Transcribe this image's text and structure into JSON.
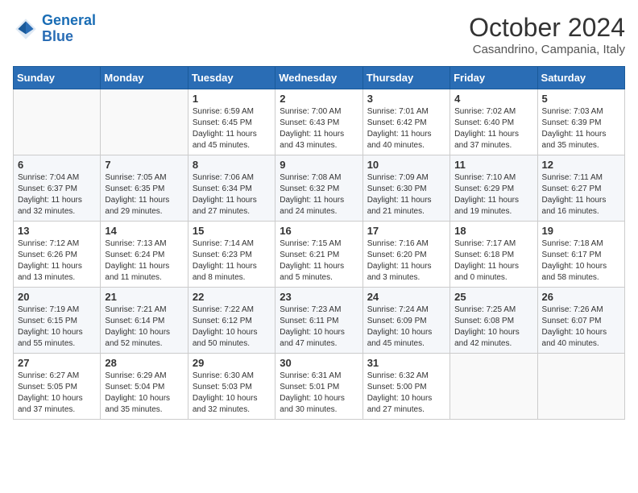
{
  "header": {
    "logo_line1": "General",
    "logo_line2": "Blue",
    "month_title": "October 2024",
    "subtitle": "Casandrino, Campania, Italy"
  },
  "days_of_week": [
    "Sunday",
    "Monday",
    "Tuesday",
    "Wednesday",
    "Thursday",
    "Friday",
    "Saturday"
  ],
  "weeks": [
    [
      {
        "day": "",
        "info": ""
      },
      {
        "day": "",
        "info": ""
      },
      {
        "day": "1",
        "info": "Sunrise: 6:59 AM\nSunset: 6:45 PM\nDaylight: 11 hours and 45 minutes."
      },
      {
        "day": "2",
        "info": "Sunrise: 7:00 AM\nSunset: 6:43 PM\nDaylight: 11 hours and 43 minutes."
      },
      {
        "day": "3",
        "info": "Sunrise: 7:01 AM\nSunset: 6:42 PM\nDaylight: 11 hours and 40 minutes."
      },
      {
        "day": "4",
        "info": "Sunrise: 7:02 AM\nSunset: 6:40 PM\nDaylight: 11 hours and 37 minutes."
      },
      {
        "day": "5",
        "info": "Sunrise: 7:03 AM\nSunset: 6:39 PM\nDaylight: 11 hours and 35 minutes."
      }
    ],
    [
      {
        "day": "6",
        "info": "Sunrise: 7:04 AM\nSunset: 6:37 PM\nDaylight: 11 hours and 32 minutes."
      },
      {
        "day": "7",
        "info": "Sunrise: 7:05 AM\nSunset: 6:35 PM\nDaylight: 11 hours and 29 minutes."
      },
      {
        "day": "8",
        "info": "Sunrise: 7:06 AM\nSunset: 6:34 PM\nDaylight: 11 hours and 27 minutes."
      },
      {
        "day": "9",
        "info": "Sunrise: 7:08 AM\nSunset: 6:32 PM\nDaylight: 11 hours and 24 minutes."
      },
      {
        "day": "10",
        "info": "Sunrise: 7:09 AM\nSunset: 6:30 PM\nDaylight: 11 hours and 21 minutes."
      },
      {
        "day": "11",
        "info": "Sunrise: 7:10 AM\nSunset: 6:29 PM\nDaylight: 11 hours and 19 minutes."
      },
      {
        "day": "12",
        "info": "Sunrise: 7:11 AM\nSunset: 6:27 PM\nDaylight: 11 hours and 16 minutes."
      }
    ],
    [
      {
        "day": "13",
        "info": "Sunrise: 7:12 AM\nSunset: 6:26 PM\nDaylight: 11 hours and 13 minutes."
      },
      {
        "day": "14",
        "info": "Sunrise: 7:13 AM\nSunset: 6:24 PM\nDaylight: 11 hours and 11 minutes."
      },
      {
        "day": "15",
        "info": "Sunrise: 7:14 AM\nSunset: 6:23 PM\nDaylight: 11 hours and 8 minutes."
      },
      {
        "day": "16",
        "info": "Sunrise: 7:15 AM\nSunset: 6:21 PM\nDaylight: 11 hours and 5 minutes."
      },
      {
        "day": "17",
        "info": "Sunrise: 7:16 AM\nSunset: 6:20 PM\nDaylight: 11 hours and 3 minutes."
      },
      {
        "day": "18",
        "info": "Sunrise: 7:17 AM\nSunset: 6:18 PM\nDaylight: 11 hours and 0 minutes."
      },
      {
        "day": "19",
        "info": "Sunrise: 7:18 AM\nSunset: 6:17 PM\nDaylight: 10 hours and 58 minutes."
      }
    ],
    [
      {
        "day": "20",
        "info": "Sunrise: 7:19 AM\nSunset: 6:15 PM\nDaylight: 10 hours and 55 minutes."
      },
      {
        "day": "21",
        "info": "Sunrise: 7:21 AM\nSunset: 6:14 PM\nDaylight: 10 hours and 52 minutes."
      },
      {
        "day": "22",
        "info": "Sunrise: 7:22 AM\nSunset: 6:12 PM\nDaylight: 10 hours and 50 minutes."
      },
      {
        "day": "23",
        "info": "Sunrise: 7:23 AM\nSunset: 6:11 PM\nDaylight: 10 hours and 47 minutes."
      },
      {
        "day": "24",
        "info": "Sunrise: 7:24 AM\nSunset: 6:09 PM\nDaylight: 10 hours and 45 minutes."
      },
      {
        "day": "25",
        "info": "Sunrise: 7:25 AM\nSunset: 6:08 PM\nDaylight: 10 hours and 42 minutes."
      },
      {
        "day": "26",
        "info": "Sunrise: 7:26 AM\nSunset: 6:07 PM\nDaylight: 10 hours and 40 minutes."
      }
    ],
    [
      {
        "day": "27",
        "info": "Sunrise: 6:27 AM\nSunset: 5:05 PM\nDaylight: 10 hours and 37 minutes."
      },
      {
        "day": "28",
        "info": "Sunrise: 6:29 AM\nSunset: 5:04 PM\nDaylight: 10 hours and 35 minutes."
      },
      {
        "day": "29",
        "info": "Sunrise: 6:30 AM\nSunset: 5:03 PM\nDaylight: 10 hours and 32 minutes."
      },
      {
        "day": "30",
        "info": "Sunrise: 6:31 AM\nSunset: 5:01 PM\nDaylight: 10 hours and 30 minutes."
      },
      {
        "day": "31",
        "info": "Sunrise: 6:32 AM\nSunset: 5:00 PM\nDaylight: 10 hours and 27 minutes."
      },
      {
        "day": "",
        "info": ""
      },
      {
        "day": "",
        "info": ""
      }
    ]
  ]
}
